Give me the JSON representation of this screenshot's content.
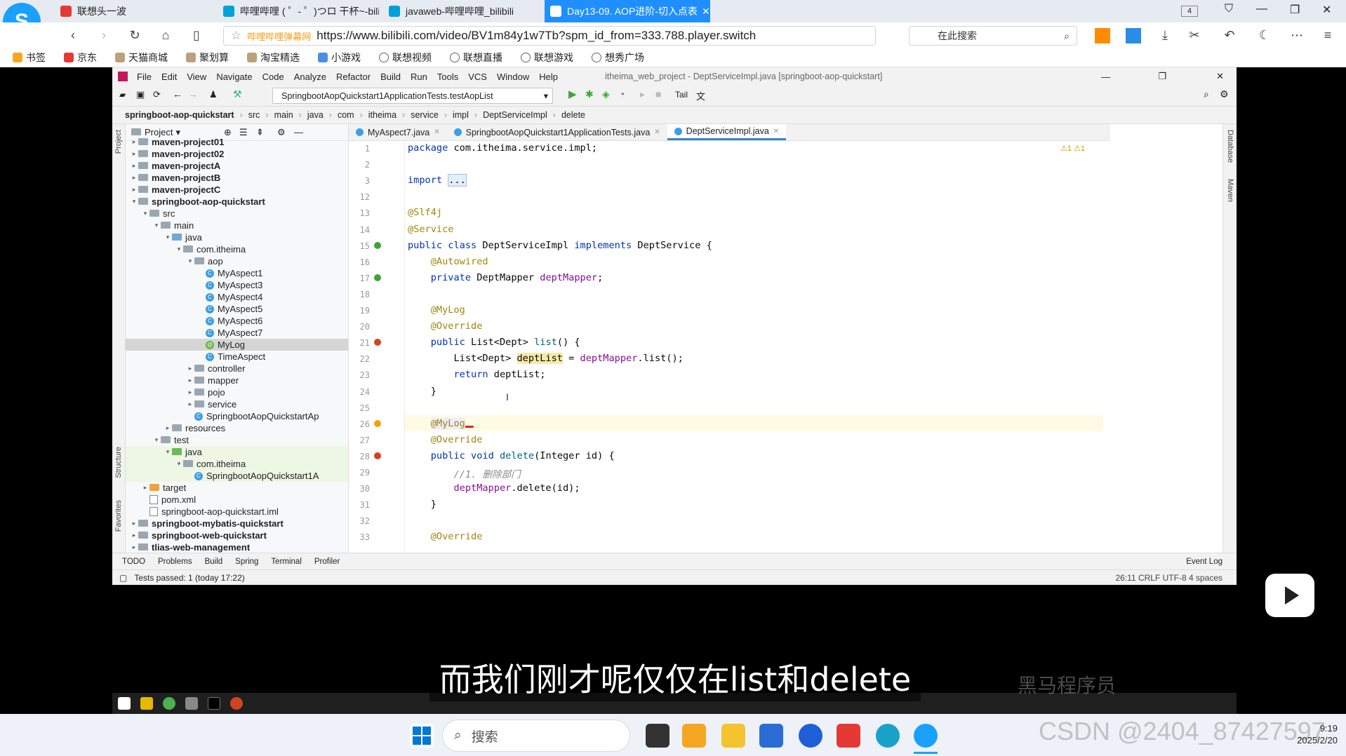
{
  "browser": {
    "tabs": [
      {
        "label": "联想头一波",
        "active": false
      },
      {
        "label": "哔哩哔哩 ( ゜- ゜)つロ 干杯~-bilib",
        "active": false
      },
      {
        "label": "javaweb-哔哩哔哩_bilibili",
        "active": false
      },
      {
        "label": "Day13-09. AOP进阶-切入点表",
        "active": true
      }
    ],
    "tab_count": "4",
    "url_site": "哔哩哔哩弹幕网",
    "url": "https://www.bilibili.com/video/BV1m84y1w7Tb?spm_id_from=333.788.player.switch",
    "search_placeholder": "在此搜索",
    "bookmarks": [
      "书签",
      "京东",
      "天猫商城",
      "聚划算",
      "淘宝精选",
      "小游戏",
      "联想视频",
      "联想直播",
      "联想游戏",
      "想秀广场"
    ]
  },
  "ide": {
    "menu": [
      "File",
      "Edit",
      "View",
      "Navigate",
      "Code",
      "Analyze",
      "Refactor",
      "Build",
      "Run",
      "Tools",
      "VCS",
      "Window",
      "Help"
    ],
    "window_title": "itheima_web_project - DeptServiceImpl.java [springboot-aop-quickstart]",
    "run_config": "SpringbootAopQuickstart1ApplicationTests.testAopList",
    "tail_label": "Tail",
    "breadcrumbs": [
      "springboot-aop-quickstart",
      "src",
      "main",
      "java",
      "com",
      "itheima",
      "service",
      "impl",
      "DeptServiceImpl",
      "delete"
    ],
    "project_header": "Project",
    "tree": [
      {
        "label": "maven-project01",
        "depth": 0,
        "type": "module",
        "arrow": "▸",
        "bold": true
      },
      {
        "label": "maven-project02",
        "depth": 0,
        "type": "module",
        "arrow": "▸",
        "bold": true
      },
      {
        "label": "maven-projectA",
        "depth": 0,
        "type": "module",
        "arrow": "▸",
        "bold": true
      },
      {
        "label": "maven-projectB",
        "depth": 0,
        "type": "module",
        "arrow": "▸",
        "bold": true
      },
      {
        "label": "maven-projectC",
        "depth": 0,
        "type": "module",
        "arrow": "▸",
        "bold": true
      },
      {
        "label": "springboot-aop-quickstart",
        "depth": 0,
        "type": "module",
        "arrow": "▾",
        "bold": true
      },
      {
        "label": "src",
        "depth": 1,
        "type": "folder",
        "arrow": "▾"
      },
      {
        "label": "main",
        "depth": 2,
        "type": "folder",
        "arrow": "▾"
      },
      {
        "label": "java",
        "depth": 3,
        "type": "blue",
        "arrow": "▾"
      },
      {
        "label": "com.itheima",
        "depth": 4,
        "type": "folder",
        "arrow": "▾"
      },
      {
        "label": "aop",
        "depth": 5,
        "type": "folder",
        "arrow": "▾"
      },
      {
        "label": "MyAspect1",
        "depth": 6,
        "type": "class",
        "arrow": ""
      },
      {
        "label": "MyAspect3",
        "depth": 6,
        "type": "class",
        "arrow": ""
      },
      {
        "label": "MyAspect4",
        "depth": 6,
        "type": "class",
        "arrow": ""
      },
      {
        "label": "MyAspect5",
        "depth": 6,
        "type": "class",
        "arrow": ""
      },
      {
        "label": "MyAspect6",
        "depth": 6,
        "type": "class",
        "arrow": ""
      },
      {
        "label": "MyAspect7",
        "depth": 6,
        "type": "class",
        "arrow": ""
      },
      {
        "label": "MyLog",
        "depth": 6,
        "type": "annotation",
        "arrow": "",
        "selected": true
      },
      {
        "label": "TimeAspect",
        "depth": 6,
        "type": "class",
        "arrow": ""
      },
      {
        "label": "controller",
        "depth": 5,
        "type": "folder",
        "arrow": "▸"
      },
      {
        "label": "mapper",
        "depth": 5,
        "type": "folder",
        "arrow": "▸"
      },
      {
        "label": "pojo",
        "depth": 5,
        "type": "folder",
        "arrow": "▸"
      },
      {
        "label": "service",
        "depth": 5,
        "type": "folder",
        "arrow": "▸"
      },
      {
        "label": "SpringbootAopQuickstartAp",
        "depth": 5,
        "type": "class",
        "arrow": ""
      },
      {
        "label": "resources",
        "depth": 3,
        "type": "folder",
        "arrow": "▸"
      },
      {
        "label": "test",
        "depth": 2,
        "type": "folder",
        "arrow": "▾"
      },
      {
        "label": "java",
        "depth": 3,
        "type": "green",
        "arrow": "▾",
        "tint": true
      },
      {
        "label": "com.itheima",
        "depth": 4,
        "type": "folder",
        "arrow": "▾",
        "tint": true
      },
      {
        "label": "SpringbootAopQuickstart1A",
        "depth": 5,
        "type": "class",
        "arrow": "",
        "tint": true
      },
      {
        "label": "target",
        "depth": 1,
        "type": "orange",
        "arrow": "▸"
      },
      {
        "label": "pom.xml",
        "depth": 1,
        "type": "file",
        "arrow": ""
      },
      {
        "label": "springboot-aop-quickstart.iml",
        "depth": 1,
        "type": "file",
        "arrow": ""
      },
      {
        "label": "springboot-mybatis-quickstart",
        "depth": 0,
        "type": "module",
        "arrow": "▸",
        "bold": true
      },
      {
        "label": "springboot-web-quickstart",
        "depth": 0,
        "type": "module",
        "arrow": "▸",
        "bold": true
      },
      {
        "label": "tlias-web-management",
        "depth": 0,
        "type": "module",
        "arrow": "▸",
        "bold": true
      }
    ],
    "editor_tabs": [
      {
        "label": "MyAspect7.java",
        "selected": false
      },
      {
        "label": "SpringbootAopQuickstart1ApplicationTests.java",
        "selected": false
      },
      {
        "label": "DeptServiceImpl.java",
        "selected": true
      }
    ],
    "inspections": "⚠1 ⚠1",
    "lines": [
      {
        "n": "1",
        "html": "<span class='kw'>package</span> com.itheima.service.impl;"
      },
      {
        "n": "2",
        "html": ""
      },
      {
        "n": "3",
        "html": "<span class='kw'>import</span> <span style='background:#e4eef9;border:1px solid #9ec2e6'>...</span>"
      },
      {
        "n": "12",
        "html": ""
      },
      {
        "n": "13",
        "html": "<span class='an'>@Slf4j</span>"
      },
      {
        "n": "14",
        "html": "<span class='an'>@Service</span>"
      },
      {
        "n": "15",
        "html": "<span class='kw'>public class</span> DeptServiceImpl <span class='kw'>implements</span> DeptService {"
      },
      {
        "n": "16",
        "html": "    <span class='an'>@Autowired</span>"
      },
      {
        "n": "17",
        "html": "    <span class='kw'>private</span> DeptMapper <span class='fld'>deptMapper</span>;"
      },
      {
        "n": "18",
        "html": ""
      },
      {
        "n": "19",
        "html": "    <span class='an'>@MyLog</span>"
      },
      {
        "n": "20",
        "html": "    <span class='an'>@Override</span>"
      },
      {
        "n": "21",
        "html": "    <span class='kw'>public</span> List&lt;Dept&gt; <span style='color:#00627a'>list</span>() {"
      },
      {
        "n": "22",
        "html": "        List&lt;Dept&gt; <span style='background:#f5eaa8'>deptList</span> = <span class='fld'>deptMapper</span>.list();"
      },
      {
        "n": "23",
        "html": "        <span class='kw'>return</span> deptList;"
      },
      {
        "n": "24",
        "html": "    }"
      },
      {
        "n": "25",
        "html": ""
      },
      {
        "n": "26",
        "html": "    <span class='an' style='background:#edebfc'>@MyLog</span>"
      },
      {
        "n": "27",
        "html": "    <span class='an'>@Override</span>"
      },
      {
        "n": "28",
        "html": "    <span class='kw'>public void</span> <span style='color:#00627a'>delete</span>(Integer id) {"
      },
      {
        "n": "29",
        "html": "        <span class='cm'>//1. 删除部门</span>"
      },
      {
        "n": "30",
        "html": "        <span class='fld'>deptMapper</span>.delete(id);"
      },
      {
        "n": "31",
        "html": "    }"
      },
      {
        "n": "32",
        "html": ""
      },
      {
        "n": "33",
        "html": "    <span class='an'>@Override</span>"
      }
    ],
    "bottom_tools": [
      "TODO",
      "Problems",
      "Build",
      "Spring",
      "Terminal",
      "Profiler",
      "Event Log"
    ],
    "status": "Tests passed: 1 (today 17:22)",
    "status_right": "26:11   CRLF   UTF-8   4 spaces",
    "side_left": [
      "Project",
      "Structure",
      "Favorites"
    ],
    "side_right": [
      "Database",
      "Maven"
    ]
  },
  "subtitle": "而我们刚才呢仅仅在list和delete",
  "taskbar": {
    "search_placeholder": "搜索",
    "time": "9:19",
    "date": "2025/2/20"
  },
  "watermark": "CSDN @2404_87427597",
  "watermark2": "黑马程序员",
  "colors": {
    "accent": "#1f8fff",
    "keyword": "#0033b3",
    "annotation": "#9e880d",
    "field": "#871094"
  }
}
